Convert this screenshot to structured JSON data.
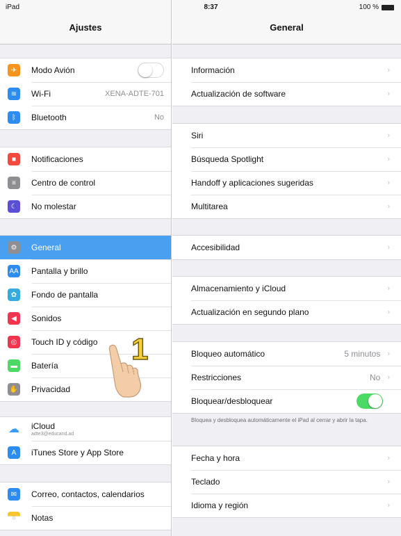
{
  "status": {
    "device": "iPad",
    "time": "8:37",
    "battery": "100 %"
  },
  "left": {
    "title": "Ajustes",
    "groups": [
      [
        {
          "label": "Modo Avión",
          "icon": "airplane-icon",
          "color": "#f7941d",
          "toggle": "off"
        },
        {
          "label": "Wi-Fi",
          "icon": "wifi-icon",
          "color": "#2d8cf0",
          "value": "XENA-ADTE-701"
        },
        {
          "label": "Bluetooth",
          "icon": "bluetooth-icon",
          "color": "#2d8cf0",
          "value": "No"
        }
      ],
      [
        {
          "label": "Notificaciones",
          "icon": "notifications-icon",
          "color": "#f24a3d"
        },
        {
          "label": "Centro de control",
          "icon": "control-center-icon",
          "color": "#8e8e93"
        },
        {
          "label": "No molestar",
          "icon": "moon-icon",
          "color": "#5b4fd6"
        }
      ],
      [
        {
          "label": "General",
          "icon": "gear-icon",
          "color": "#8e8e93",
          "selected": true
        },
        {
          "label": "Pantalla y brillo",
          "icon": "display-icon",
          "color": "#2d8cf0"
        },
        {
          "label": "Fondo de pantalla",
          "icon": "wallpaper-icon",
          "color": "#36aadc"
        },
        {
          "label": "Sonidos",
          "icon": "sound-icon",
          "color": "#f2354f"
        },
        {
          "label": "Touch ID y código",
          "icon": "fingerprint-icon",
          "color": "#f2354f"
        },
        {
          "label": "Batería",
          "icon": "battery-icon",
          "color": "#4cd964"
        },
        {
          "label": "Privacidad",
          "icon": "hand-icon",
          "color": "#8e8e93"
        }
      ],
      [
        {
          "label": "iCloud",
          "icon": "cloud-icon",
          "color": "#ffffff",
          "sub": "adte3@educand.ad"
        },
        {
          "label": "iTunes Store y App Store",
          "icon": "appstore-icon",
          "color": "#2d8cf0"
        }
      ],
      [
        {
          "label": "Correo, contactos, calendarios",
          "icon": "mail-icon",
          "color": "#2d8cf0"
        },
        {
          "label": "Notas",
          "icon": "notes-icon",
          "color": "#f7c52d"
        }
      ]
    ]
  },
  "right": {
    "title": "General",
    "groups": [
      [
        {
          "label": "Información"
        },
        {
          "label": "Actualización de software"
        }
      ],
      [
        {
          "label": "Siri"
        },
        {
          "label": "Búsqueda Spotlight"
        },
        {
          "label": "Handoff y aplicaciones sugeridas"
        },
        {
          "label": "Multitarea"
        }
      ],
      [
        {
          "label": "Accesibilidad"
        }
      ],
      [
        {
          "label": "Almacenamiento y iCloud"
        },
        {
          "label": "Actualización en segundo plano"
        }
      ],
      [
        {
          "label": "Bloqueo automático",
          "value": "5 minutos"
        },
        {
          "label": "Restricciones",
          "value": "No"
        },
        {
          "label": "Bloquear/desbloquear",
          "toggle": "on"
        }
      ],
      [
        {
          "label": "Fecha y hora"
        },
        {
          "label": "Teclado"
        },
        {
          "label": "Idioma y región"
        }
      ]
    ],
    "lock_note": "Bloquea y desbloquea automáticamente el iPad al cerrar y abrir la tapa."
  },
  "annotation": {
    "step": "1"
  },
  "colors": {
    "accent": "#4aa0f0",
    "toggle_on": "#4cd964",
    "background": "#efeff4"
  }
}
